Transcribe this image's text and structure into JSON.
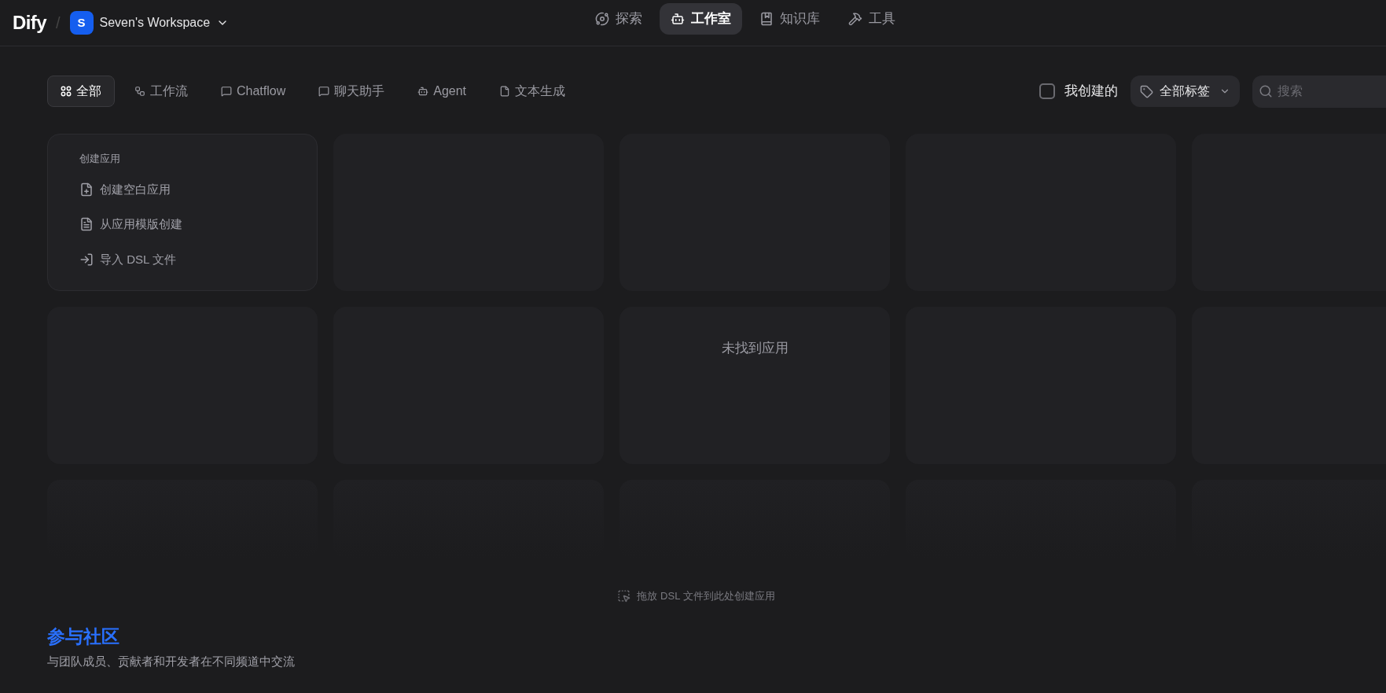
{
  "header": {
    "logo": "Dify",
    "separator": "/",
    "workspace": {
      "initial": "S",
      "name": "Seven's Workspace"
    },
    "nav": [
      {
        "label": "探索",
        "selected": false
      },
      {
        "label": "工作室",
        "selected": true
      },
      {
        "label": "知识库",
        "selected": false
      },
      {
        "label": "工具",
        "selected": false
      }
    ]
  },
  "filters": {
    "tabs": [
      {
        "label": "全部",
        "selected": true
      },
      {
        "label": "工作流",
        "selected": false
      },
      {
        "label": "Chatflow",
        "selected": false
      },
      {
        "label": "聊天助手",
        "selected": false
      },
      {
        "label": "Agent",
        "selected": false
      },
      {
        "label": "文本生成",
        "selected": false
      }
    ],
    "my_created": {
      "label": "我创建的",
      "checked": false
    },
    "tag_filter": "全部标签",
    "search": {
      "placeholder": "搜索"
    }
  },
  "create_card": {
    "title": "创建应用",
    "actions": [
      "创建空白应用",
      "从应用模版创建",
      "导入 DSL 文件"
    ]
  },
  "empty_message": "未找到应用",
  "drop_hint": "拖放 DSL 文件到此处创建应用",
  "community": {
    "title": "参与社区",
    "subtitle": "与团队成员、贡献者和开发者在不同频道中交流"
  }
}
